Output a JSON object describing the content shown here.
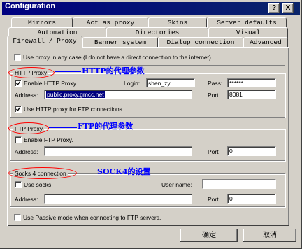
{
  "window": {
    "title": "Configuration",
    "help_button": "?",
    "close_button": "X"
  },
  "colors": {
    "title_bar": "#000080",
    "face": "#d4d0c8",
    "annotation": "#0000ff",
    "highlight_ellipse": "#ff0000",
    "selection": "#000080"
  },
  "tabs": {
    "row1": [
      "Mirrors",
      "Act as proxy",
      "Skins",
      "Server defaults"
    ],
    "row2": [
      "Automation",
      "Directories",
      "Visual"
    ],
    "row3": [
      "Firewall / Proxy",
      "Banner system",
      "Dialup connection",
      "Advanced"
    ],
    "selected_row": 3,
    "selected_index": 0
  },
  "proxy_any_case": {
    "label": "Use proxy in any case (I do not have a direct connection to the internet).",
    "checked": false
  },
  "http_proxy": {
    "group_label": "HTTP Proxy",
    "annotation": "HTTP的代理参数",
    "enable": {
      "label": "Enable HTTP Proxy.",
      "checked": true
    },
    "login": {
      "label": "Login:",
      "value": "shen_zy"
    },
    "pass": {
      "label": "Pass:",
      "value": "******"
    },
    "address": {
      "label": "Address:",
      "value": "public.proxy.gmcc.net"
    },
    "port": {
      "label": "Port",
      "value": "8081"
    },
    "use_for_ftp": {
      "label": "Use HTTP proxy for FTP connections.",
      "checked": true
    }
  },
  "ftp_proxy": {
    "group_label": "FTP Proxy",
    "annotation": "FTP的代理参数",
    "enable": {
      "label": "Enable FTP Proxy.",
      "checked": false
    },
    "address": {
      "label": "Address:",
      "value": ""
    },
    "port": {
      "label": "Port",
      "value": "0"
    }
  },
  "socks": {
    "group_label": "Socks 4 connection",
    "annotation": "SOCK4的设置",
    "use_socks": {
      "label": "Use socks",
      "checked": false
    },
    "user_name": {
      "label": "User name:",
      "value": ""
    },
    "address": {
      "label": "Address:",
      "value": ""
    },
    "port": {
      "label": "Port",
      "value": "0"
    }
  },
  "passive_mode": {
    "label": "Use Passive mode when connecting to FTP servers.",
    "checked": false
  },
  "buttons": {
    "ok": "确定",
    "cancel": "取消"
  }
}
